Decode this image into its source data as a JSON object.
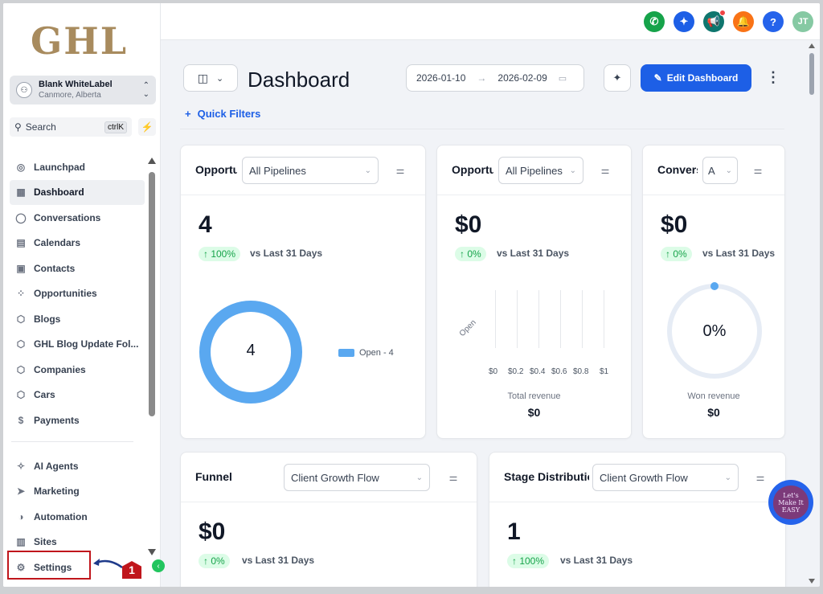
{
  "logo": "GHL",
  "account": {
    "name": "Blank WhiteLabel",
    "location": "Canmore, Alberta"
  },
  "search": {
    "label": "Search",
    "shortcut": "ctrlK"
  },
  "nav": [
    {
      "label": "Launchpad",
      "icon": "rocket-icon",
      "glyph": "◎"
    },
    {
      "label": "Dashboard",
      "icon": "dashboard-grid-icon",
      "glyph": "▦"
    },
    {
      "label": "Conversations",
      "icon": "chat-bubble-icon",
      "glyph": "◯"
    },
    {
      "label": "Calendars",
      "icon": "calendar-icon",
      "glyph": "▤"
    },
    {
      "label": "Contacts",
      "icon": "contacts-book-icon",
      "glyph": "▣"
    },
    {
      "label": "Opportunities",
      "icon": "opportunities-icon",
      "glyph": "⁘"
    },
    {
      "label": "Blogs",
      "icon": "cube-icon",
      "glyph": "⬡"
    },
    {
      "label": "GHL Blog Update Fol...",
      "icon": "cube-icon",
      "glyph": "⬡"
    },
    {
      "label": "Companies",
      "icon": "cube-icon",
      "glyph": "⬡"
    },
    {
      "label": "Cars",
      "icon": "cube-icon",
      "glyph": "⬡"
    },
    {
      "label": "Payments",
      "icon": "payments-icon",
      "glyph": "$"
    }
  ],
  "nav2": [
    {
      "label": "AI Agents",
      "icon": "sparkles-icon",
      "glyph": "✧"
    },
    {
      "label": "Marketing",
      "icon": "send-icon",
      "glyph": "➤"
    },
    {
      "label": "Automation",
      "icon": "automation-icon",
      "glyph": "◑"
    },
    {
      "label": "Sites",
      "icon": "sites-icon",
      "glyph": "▥"
    },
    {
      "label": "Settings",
      "icon": "gear-icon",
      "glyph": "⚙"
    }
  ],
  "annotation": {
    "number": "1"
  },
  "topbar": {
    "avatar": "JT",
    "help": "?",
    "colors": {
      "phone": "#16a34a",
      "magic": "#1d5fe6",
      "announce": "#0f766e",
      "bell": "#f97316",
      "help": "#2563eb",
      "avatar": "#86c9a3"
    }
  },
  "header": {
    "title": "Dashboard",
    "date_start": "2026-01-10",
    "date_end": "2026-02-09",
    "edit_label": "Edit Dashboard",
    "quick_filters": "Quick Filters"
  },
  "cards": {
    "opp1": {
      "title": "Opportunities",
      "select": "All Pipelines",
      "value": "4",
      "change": "↑ 100%",
      "vs": "vs Last 31 Days",
      "donut_value": "4",
      "legend": "Open - 4"
    },
    "opp2": {
      "title": "Opportunities",
      "select": "All Pipelines",
      "value": "$0",
      "change": "↑ 0%",
      "vs": "vs Last 31 Days",
      "bar_label": "Open",
      "ticks": [
        "$0",
        "$0.2",
        "$0.4",
        "$0.6",
        "$0.8",
        "$1"
      ],
      "footer_label": "Total revenue",
      "footer_value": "$0"
    },
    "conv": {
      "title": "Conversions",
      "select": "A",
      "value": "$0",
      "change": "↑ 0%",
      "vs": "vs Last 31 Days",
      "gauge_value": "0%",
      "footer_label": "Won revenue",
      "footer_value": "$0"
    },
    "funnel": {
      "title": "Funnel",
      "select": "Client Growth Flow",
      "value": "$0",
      "change": "↑ 0%",
      "vs": "vs Last 31 Days"
    },
    "stage": {
      "title": "Stage Distribution",
      "select": "Client Growth Flow",
      "value": "1",
      "change": "↑ 100%",
      "vs": "vs Last 31 Days"
    }
  },
  "easy_badge": "Let's Make It EASY"
}
